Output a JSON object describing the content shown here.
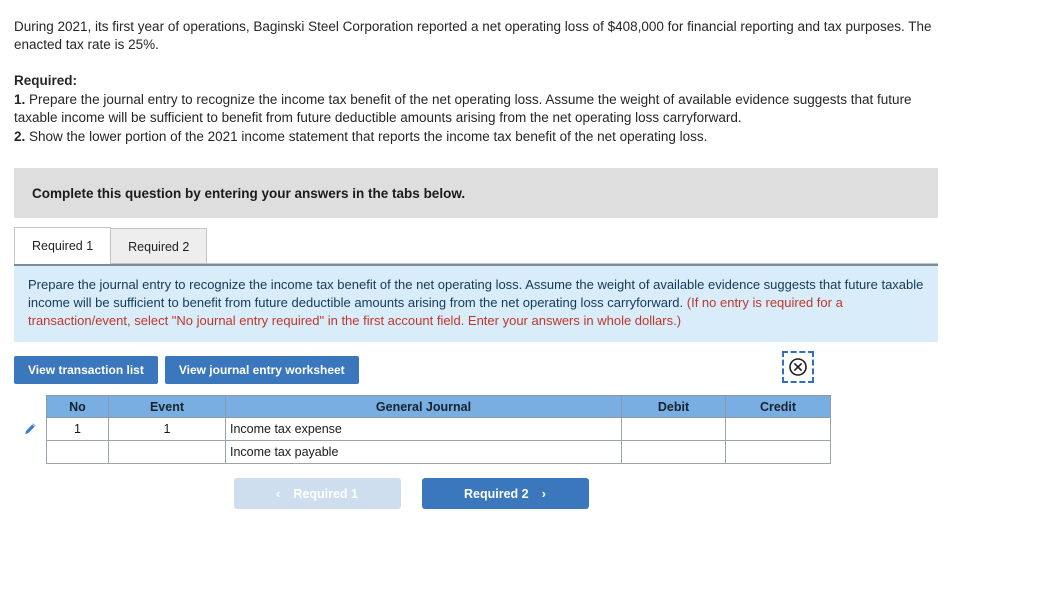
{
  "stem": "During 2021, its first year of operations, Baginski Steel Corporation reported a net operating loss of $408,000 for financial reporting and tax purposes. The enacted tax rate is 25%.",
  "required": {
    "title": "Required:",
    "items": [
      {
        "num": "1.",
        "text": "Prepare the journal entry to recognize the income tax benefit of the net operating loss. Assume the weight of available evidence suggests that future taxable income will be sufficient to benefit from future deductible amounts arising from the net operating loss carryforward."
      },
      {
        "num": "2.",
        "text": "Show the lower portion of the 2021 income statement that reports the income tax benefit of the net operating loss."
      }
    ]
  },
  "banner": {
    "text": "Complete this question by entering your answers in the tabs below."
  },
  "tabs": [
    {
      "label": "Required 1",
      "active": true
    },
    {
      "label": "Required 2",
      "active": false
    }
  ],
  "instruction": {
    "main": "Prepare the journal entry to recognize the income tax benefit of the net operating loss. Assume the weight of available evidence suggests that future taxable income will be sufficient to benefit from future deductible amounts arising from the net operating loss carryforward. ",
    "hint": "(If no entry is required for a transaction/event, select \"No journal entry required\" in the first account field. Enter your answers in whole dollars.)"
  },
  "actions": {
    "view_transaction_list": "View transaction list",
    "view_journal_entry_worksheet": "View journal entry worksheet",
    "close_icon": "circled-x-icon"
  },
  "journal": {
    "headers": [
      "No",
      "Event",
      "General Journal",
      "Debit",
      "Credit"
    ],
    "rows": [
      {
        "edit_icon": "pencil-icon",
        "no": "1",
        "event": "1",
        "general_journal": "Income tax expense",
        "debit": "",
        "credit": ""
      },
      {
        "edit_icon": "",
        "no": "",
        "event": "",
        "general_journal": "Income tax payable",
        "debit": "",
        "credit": ""
      }
    ]
  },
  "nav": {
    "prev_label": "Required 1",
    "prev_chevron": "‹",
    "next_label": "Required 2",
    "next_chevron": "›"
  },
  "colors": {
    "accent_blue": "#3b77bc",
    "table_header_blue": "#78aee2",
    "instruction_bg": "#d9ecf9",
    "hint_red": "#bf372c",
    "banner_grey": "#dedede",
    "disabled_blue": "#cfdeee"
  }
}
